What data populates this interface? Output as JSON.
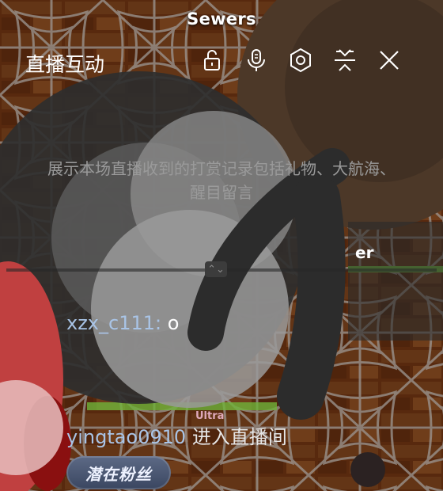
{
  "game": {
    "area_title": "Sewers",
    "name_fragment": "er",
    "tag_fragment": "Ultra"
  },
  "panel": {
    "title": "直播互动",
    "controls": [
      {
        "name": "lock-icon"
      },
      {
        "name": "microphone-icon"
      },
      {
        "name": "settings-hexagon-icon"
      },
      {
        "name": "collapse-icon"
      },
      {
        "name": "close-icon"
      }
    ],
    "empty_hint": "展示本场直播收到的打赏记录包括礼物、大航海、醒目留言"
  },
  "chat": [
    {
      "user": "xzx_c111:",
      "text": "o"
    },
    {
      "user": "yingtao0910",
      "text": "进入直播间"
    }
  ],
  "badge": {
    "label": "潜在粉丝"
  },
  "colors": {
    "username": "#a9c4e6",
    "hint": "#9a9a9a",
    "panel_accent": "#ffffff"
  }
}
